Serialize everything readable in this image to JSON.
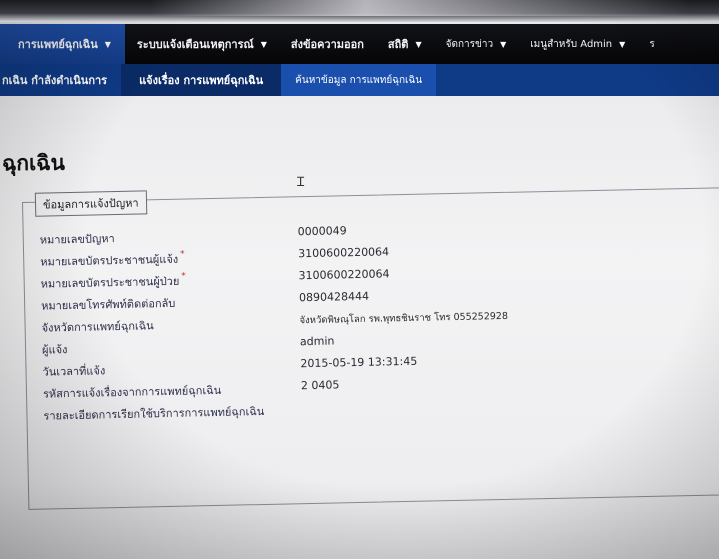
{
  "topnav": {
    "items": [
      {
        "label": "การแพทย์ฉุกเฉิน",
        "caret": "▼"
      },
      {
        "label": "ระบบแจ้งเตือนเหตุการณ์",
        "caret": "▼"
      },
      {
        "label": "ส่งข้อความออก",
        "caret": ""
      },
      {
        "label": "สถิติ",
        "caret": "▼"
      },
      {
        "label": "จัดการข่าว",
        "caret": "▼"
      },
      {
        "label": "เมนูสำหรับ Admin",
        "caret": "▼"
      },
      {
        "label": "ร",
        "caret": ""
      }
    ]
  },
  "subnav": {
    "items": [
      {
        "label": "กเฉิน กำลังดำเนินการ"
      },
      {
        "label": "แจ้งเรื่อง การแพทย์ฉุกเฉิน"
      },
      {
        "label": "ค้นหาข้อมูล การแพทย์ฉุกเฉิน"
      }
    ]
  },
  "page": {
    "title": "ฉุกเฉิน"
  },
  "panel": {
    "legend": "ข้อมูลการแจ้งปัญหา",
    "labels": [
      {
        "text": "หมายเลขปัญหา",
        "required": ""
      },
      {
        "text": "หมายเลขบัตรประชาชนผู้แจ้ง",
        "required": "*"
      },
      {
        "text": "หมายเลขบัตรประชาชนผู้ป่วย",
        "required": "*"
      },
      {
        "text": "หมายเลขโทรศัพท์ติดต่อกลับ",
        "required": ""
      },
      {
        "text": "จังหวัดการแพทย์ฉุกเฉิน",
        "required": ""
      },
      {
        "text": "ผู้แจ้ง",
        "required": ""
      },
      {
        "text": "วันเวลาที่แจ้ง",
        "required": ""
      },
      {
        "text": "รหัสการแจ้งเรื่องจากการแพทย์ฉุกเฉิน",
        "required": ""
      },
      {
        "text": "รายละเอียดการเรียกใช้บริการการแพทย์ฉุกเฉิน",
        "required": ""
      }
    ],
    "values": [
      "0000049",
      "3100600220064",
      "3100600220064",
      "0890428444",
      "จังหวัดพิษณุโลก รพ.พุทธชินราช โทร 055252928",
      "admin",
      "2015-05-19 13:31:45",
      "2 0405",
      ""
    ]
  },
  "colors": {
    "nav_active": "#1f4ea6",
    "nav_bg": "#08090c",
    "subnav_bg": "#0f3a86"
  }
}
